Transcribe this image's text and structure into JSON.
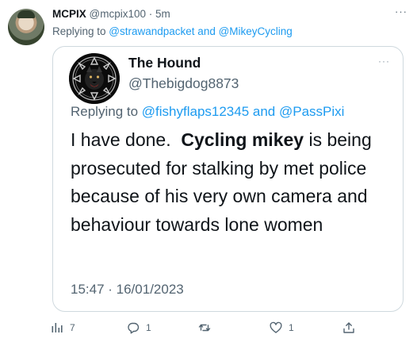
{
  "tweet": {
    "author_name": "MCPIX",
    "handle_time": "@mcpix100 · 5m",
    "replying_prefix": "Replying to ",
    "replying_to": "@strawandpacket and @MikeyCycling",
    "more_icon": "more-icon"
  },
  "quote": {
    "author_name": "The Hound",
    "handle": "@Thebigdog8873",
    "replying_prefix": "Replying to ",
    "replying_to": "@fishyflaps12345 and @PassPixi",
    "text_start": "I have done.",
    "text_bold": "Cycling mikey",
    "text_end": "is being prosecuted for stalking by met police because of his very own camera and behaviour towards lone women",
    "date": "15:47 · 16/01/2023"
  },
  "actions": {
    "views_count": "7",
    "reply_count": "1",
    "retweet_count": "",
    "like_count": "1",
    "icons": [
      "views-icon",
      "reply-icon",
      "retweet-icon",
      "like-icon",
      "share-icon"
    ]
  },
  "colors": {
    "text": "#0f1419",
    "secondary": "#536471",
    "link": "#1d9bf0",
    "border": "#cfd9de"
  }
}
